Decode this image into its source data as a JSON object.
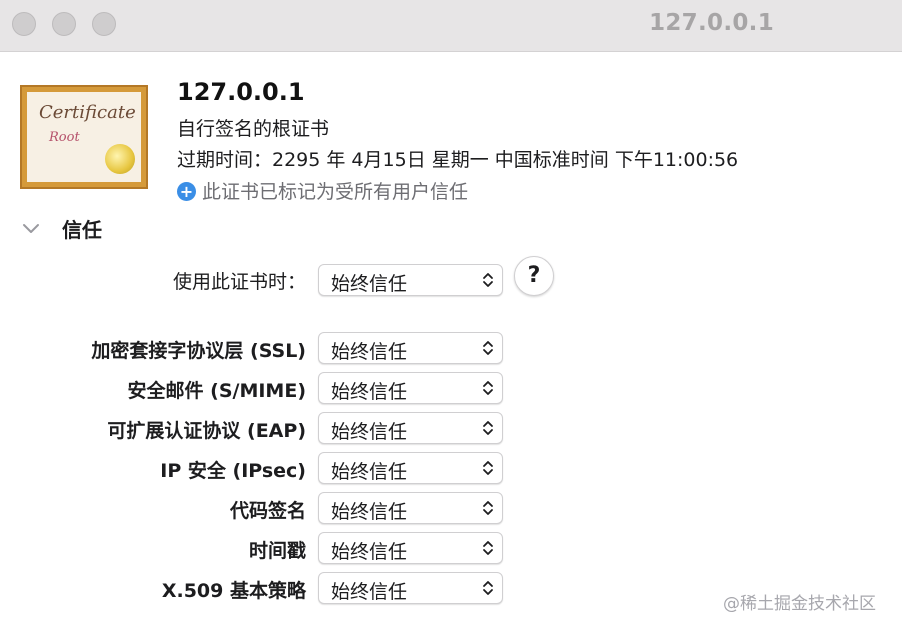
{
  "window": {
    "title": "127.0.0.1"
  },
  "certificate": {
    "icon_text_1": "Certificate",
    "icon_text_2": "Root",
    "name": "127.0.0.1",
    "kind": "自行签名的根证书",
    "expiry": "过期时间：2295 年 4月15日 星期一 中国标准时间 下午11:00:56",
    "trust_note": "此证书已标记为受所有用户信任"
  },
  "trust": {
    "section_label": "信任",
    "when_using_label": "使用此证书时：",
    "when_using_value": "始终信任",
    "help_label": "?",
    "rows": [
      {
        "label": "加密套接字协议层 (SSL)",
        "value": "始终信任"
      },
      {
        "label": "安全邮件 (S/MIME)",
        "value": "始终信任"
      },
      {
        "label": "可扩展认证协议 (EAP)",
        "value": "始终信任"
      },
      {
        "label": "IP 安全 (IPsec)",
        "value": "始终信任"
      },
      {
        "label": "代码签名",
        "value": "始终信任"
      },
      {
        "label": "时间戳",
        "value": "始终信任"
      },
      {
        "label": "X.509 基本策略",
        "value": "始终信任"
      }
    ]
  },
  "watermark": "@稀土掘金技术社区",
  "colors": {
    "accent": "#3a8ee6",
    "titlebar": "#e7e5e6",
    "muted_text": "#6e6e73"
  },
  "icons": [
    "close-button",
    "minimize-button",
    "zoom-button",
    "certificate-icon",
    "plus-circle-icon",
    "chevron-down-icon",
    "updown-arrows-icon",
    "help-button"
  ]
}
